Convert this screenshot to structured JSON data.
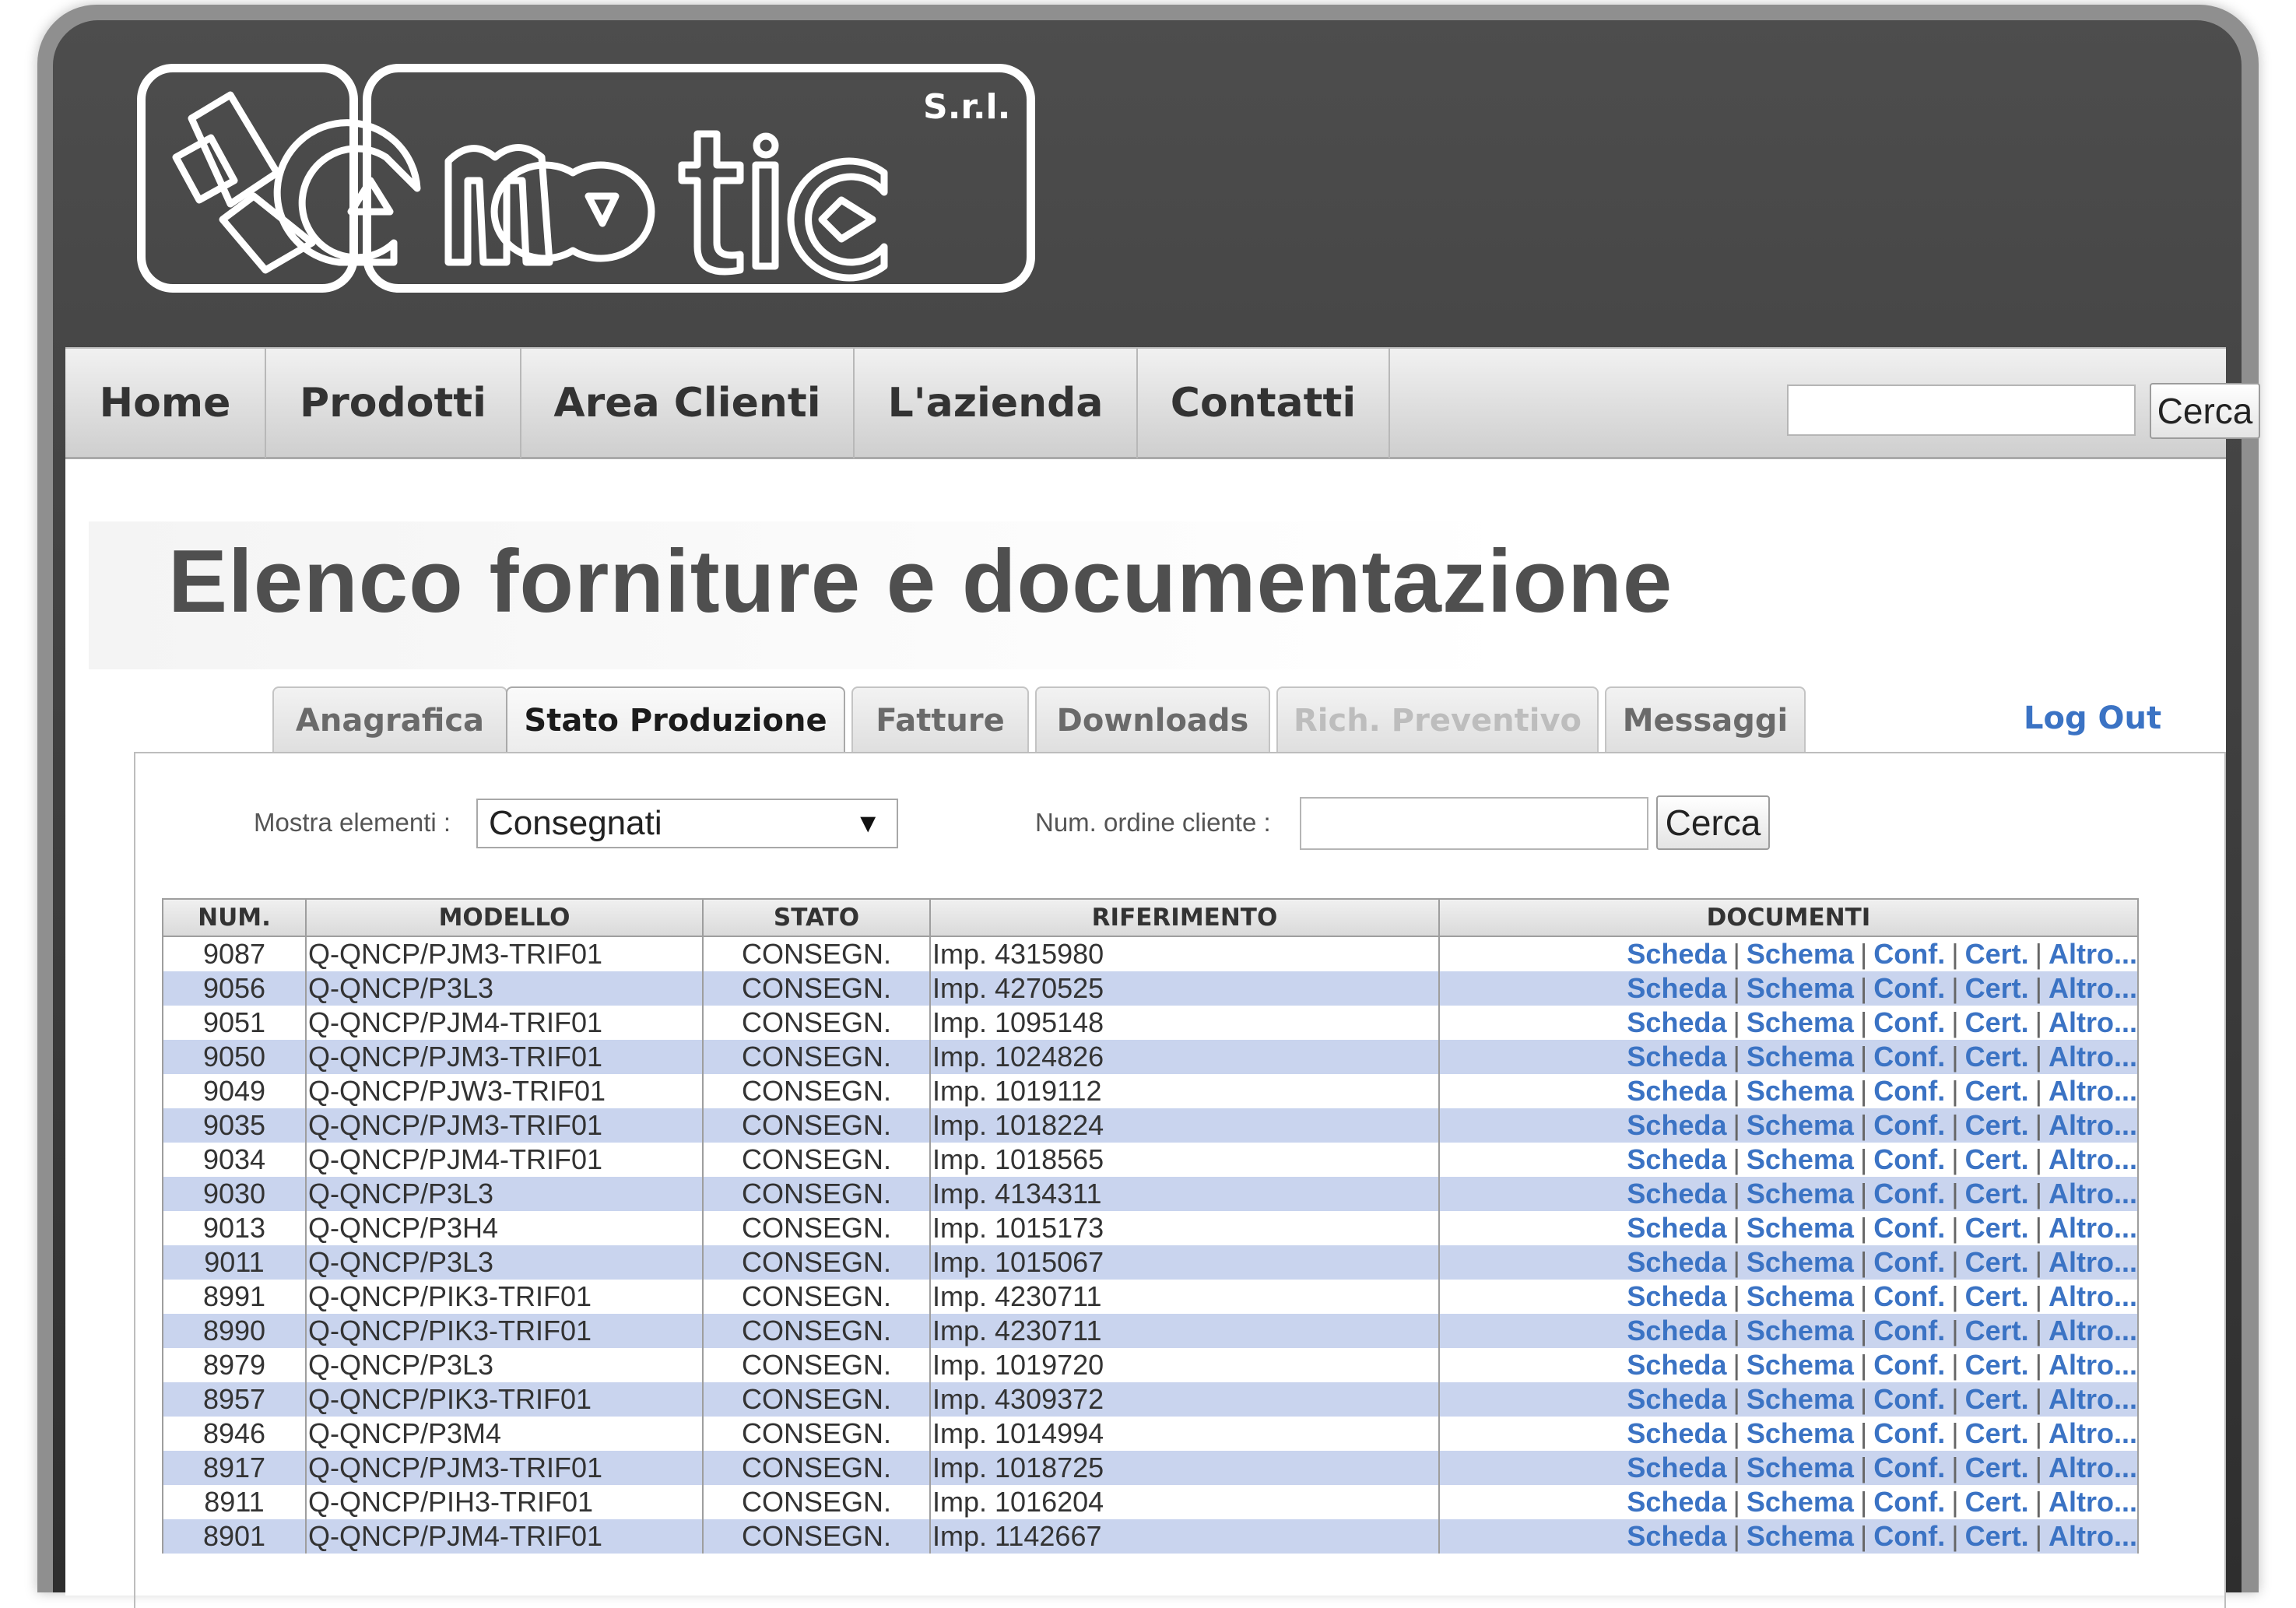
{
  "brand": {
    "logo_text": "ematic",
    "logo_suffix": "S.r.l."
  },
  "nav": {
    "items": [
      {
        "label": "Home"
      },
      {
        "label": "Prodotti"
      },
      {
        "label": "Area Clienti"
      },
      {
        "label": "L'azienda"
      },
      {
        "label": "Contatti"
      }
    ],
    "search_button": "Cerca",
    "search_value": ""
  },
  "page": {
    "title": "Elenco forniture e documentazione"
  },
  "tabs": [
    {
      "label": "Anagrafica",
      "state": "normal"
    },
    {
      "label": "Stato Produzione",
      "state": "active"
    },
    {
      "label": "Fatture",
      "state": "normal"
    },
    {
      "label": "Downloads",
      "state": "normal"
    },
    {
      "label": "Rich. Preventivo",
      "state": "disabled"
    },
    {
      "label": "Messaggi",
      "state": "normal"
    }
  ],
  "logout_label": "Log Out",
  "filters": {
    "show_label": "Mostra elementi :",
    "show_selected": "Consegnati",
    "order_label": "Num. ordine cliente :",
    "order_value": "",
    "search_button": "Cerca"
  },
  "table": {
    "columns": [
      "NUM.",
      "MODELLO",
      "STATO",
      "RIFERIMENTO",
      "DOCUMENTI"
    ],
    "doc_links": [
      "Scheda",
      "Schema",
      "Conf.",
      "Cert.",
      "Altro..."
    ],
    "rows": [
      {
        "num": "9087",
        "modello": "Q-QNCP/PJM3-TRIF01",
        "stato": "CONSEGN.",
        "riferimento": "Imp. 4315980"
      },
      {
        "num": "9056",
        "modello": "Q-QNCP/P3L3",
        "stato": "CONSEGN.",
        "riferimento": "Imp. 4270525"
      },
      {
        "num": "9051",
        "modello": "Q-QNCP/PJM4-TRIF01",
        "stato": "CONSEGN.",
        "riferimento": "Imp. 1095148"
      },
      {
        "num": "9050",
        "modello": "Q-QNCP/PJM3-TRIF01",
        "stato": "CONSEGN.",
        "riferimento": "Imp. 1024826"
      },
      {
        "num": "9049",
        "modello": "Q-QNCP/PJW3-TRIF01",
        "stato": "CONSEGN.",
        "riferimento": "Imp. 1019112"
      },
      {
        "num": "9035",
        "modello": "Q-QNCP/PJM3-TRIF01",
        "stato": "CONSEGN.",
        "riferimento": "Imp. 1018224"
      },
      {
        "num": "9034",
        "modello": "Q-QNCP/PJM4-TRIF01",
        "stato": "CONSEGN.",
        "riferimento": "Imp. 1018565"
      },
      {
        "num": "9030",
        "modello": "Q-QNCP/P3L3",
        "stato": "CONSEGN.",
        "riferimento": "Imp. 4134311"
      },
      {
        "num": "9013",
        "modello": "Q-QNCP/P3H4",
        "stato": "CONSEGN.",
        "riferimento": "Imp. 1015173"
      },
      {
        "num": "9011",
        "modello": "Q-QNCP/P3L3",
        "stato": "CONSEGN.",
        "riferimento": "Imp. 1015067"
      },
      {
        "num": "8991",
        "modello": "Q-QNCP/PIK3-TRIF01",
        "stato": "CONSEGN.",
        "riferimento": "Imp. 4230711"
      },
      {
        "num": "8990",
        "modello": "Q-QNCP/PIK3-TRIF01",
        "stato": "CONSEGN.",
        "riferimento": "Imp. 4230711"
      },
      {
        "num": "8979",
        "modello": "Q-QNCP/P3L3",
        "stato": "CONSEGN.",
        "riferimento": "Imp. 1019720"
      },
      {
        "num": "8957",
        "modello": "Q-QNCP/PIK3-TRIF01",
        "stato": "CONSEGN.",
        "riferimento": "Imp. 4309372"
      },
      {
        "num": "8946",
        "modello": "Q-QNCP/P3M4",
        "stato": "CONSEGN.",
        "riferimento": "Imp. 1014994"
      },
      {
        "num": "8917",
        "modello": "Q-QNCP/PJM3-TRIF01",
        "stato": "CONSEGN.",
        "riferimento": "Imp. 1018725"
      },
      {
        "num": "8911",
        "modello": "Q-QNCP/PIH3-TRIF01",
        "stato": "CONSEGN.",
        "riferimento": "Imp. 1016204"
      },
      {
        "num": "8901",
        "modello": "Q-QNCP/PJM4-TRIF01",
        "stato": "CONSEGN.",
        "riferimento": "Imp. 1142667"
      }
    ]
  },
  "colors": {
    "link": "#3b73c4",
    "row_alt": "#c9d4ee",
    "header_dark": "#3c3c3c"
  },
  "icons": {
    "dropdown": "triangle-down-icon",
    "logo": "ematic-logo-icon"
  }
}
